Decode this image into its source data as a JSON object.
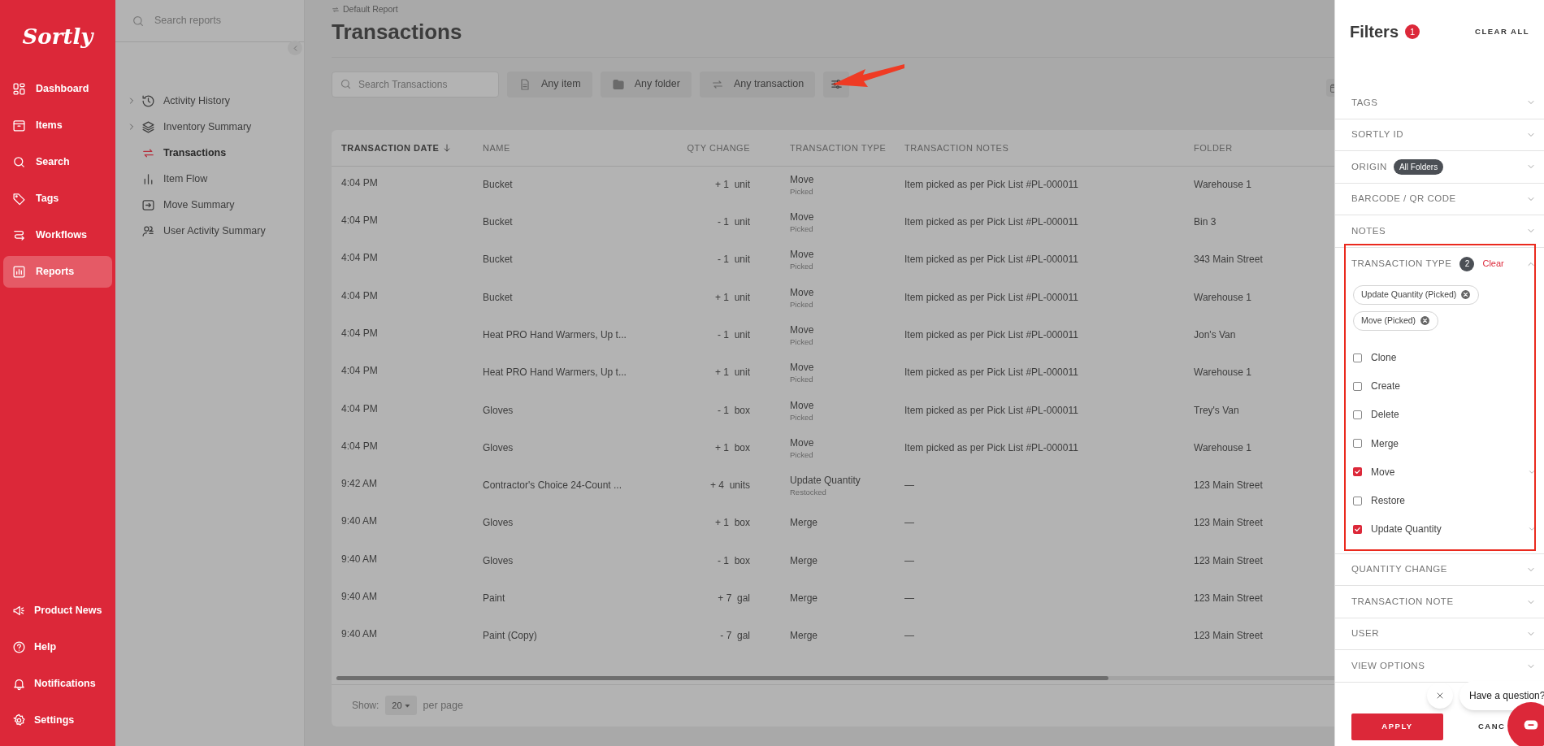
{
  "sidebar": {
    "logo": "Sortly",
    "items": [
      {
        "label": "Dashboard",
        "selected": false
      },
      {
        "label": "Items",
        "selected": false
      },
      {
        "label": "Search",
        "selected": false
      },
      {
        "label": "Tags",
        "selected": false
      },
      {
        "label": "Workflows",
        "selected": false
      },
      {
        "label": "Reports",
        "selected": true
      }
    ],
    "bottom_items": [
      {
        "label": "Product News"
      },
      {
        "label": "Help"
      },
      {
        "label": "Notifications"
      },
      {
        "label": "Settings"
      }
    ]
  },
  "reports_panel": {
    "search": {
      "placeholder": "Search reports"
    },
    "items": [
      {
        "label": "Activity History",
        "expandable": true,
        "selected": false
      },
      {
        "label": "Inventory Summary",
        "expandable": true,
        "selected": false
      },
      {
        "label": "Transactions",
        "expandable": false,
        "selected": true
      },
      {
        "label": "Item Flow",
        "expandable": false,
        "selected": false
      },
      {
        "label": "Move Summary",
        "expandable": false,
        "selected": false
      },
      {
        "label": "User Activity Summary",
        "expandable": false,
        "selected": false
      }
    ]
  },
  "main": {
    "breadcrumb": "Default Report",
    "title": "Transactions",
    "search": {
      "placeholder": "Search Transactions"
    },
    "filter_chips": [
      "Any item",
      "Any folder",
      "Any transaction"
    ],
    "table": {
      "columns": [
        "TRANSACTION DATE",
        "NAME",
        "QTY CHANGE",
        "TRANSACTION TYPE",
        "TRANSACTION NOTES",
        "FOLDER"
      ],
      "rows": [
        {
          "date": "4:04 PM",
          "name": "Bucket",
          "qty": "+ 1",
          "unit": "unit",
          "type": "Move",
          "subtype": "Picked",
          "notes": "Item picked as per Pick List #PL-000011",
          "folder": "Warehouse 1"
        },
        {
          "date": "4:04 PM",
          "name": "Bucket",
          "qty": "- 1",
          "unit": "unit",
          "type": "Move",
          "subtype": "Picked",
          "notes": "Item picked as per Pick List #PL-000011",
          "folder": "Bin 3"
        },
        {
          "date": "4:04 PM",
          "name": "Bucket",
          "qty": "- 1",
          "unit": "unit",
          "type": "Move",
          "subtype": "Picked",
          "notes": "Item picked as per Pick List #PL-000011",
          "folder": "343 Main Street"
        },
        {
          "date": "4:04 PM",
          "name": "Bucket",
          "qty": "+ 1",
          "unit": "unit",
          "type": "Move",
          "subtype": "Picked",
          "notes": "Item picked as per Pick List #PL-000011",
          "folder": "Warehouse 1"
        },
        {
          "date": "4:04 PM",
          "name": "Heat PRO Hand Warmers, Up t...",
          "qty": "- 1",
          "unit": "unit",
          "type": "Move",
          "subtype": "Picked",
          "notes": "Item picked as per Pick List #PL-000011",
          "folder": "Jon's Van"
        },
        {
          "date": "4:04 PM",
          "name": "Heat PRO Hand Warmers, Up t...",
          "qty": "+ 1",
          "unit": "unit",
          "type": "Move",
          "subtype": "Picked",
          "notes": "Item picked as per Pick List #PL-000011",
          "folder": "Warehouse 1"
        },
        {
          "date": "4:04 PM",
          "name": "Gloves",
          "qty": "- 1",
          "unit": "box",
          "type": "Move",
          "subtype": "Picked",
          "notes": "Item picked as per Pick List #PL-000011",
          "folder": "Trey's Van"
        },
        {
          "date": "4:04 PM",
          "name": "Gloves",
          "qty": "+ 1",
          "unit": "box",
          "type": "Move",
          "subtype": "Picked",
          "notes": "Item picked as per Pick List #PL-000011",
          "folder": "Warehouse 1"
        },
        {
          "date": "9:42 AM",
          "name": "Contractor's Choice 24-Count ...",
          "qty": "+ 4",
          "unit": "units",
          "type": "Update Quantity",
          "subtype": "Restocked",
          "notes": "—",
          "folder": "123 Main Street"
        },
        {
          "date": "9:40 AM",
          "name": "Gloves",
          "qty": "+ 1",
          "unit": "box",
          "type": "Merge",
          "notes": "—",
          "folder": "123 Main Street"
        },
        {
          "date": "9:40 AM",
          "name": "Gloves",
          "qty": "- 1",
          "unit": "box",
          "type": "Merge",
          "notes": "—",
          "folder": "123 Main Street"
        },
        {
          "date": "9:40 AM",
          "name": "Paint",
          "qty": "+ 7",
          "unit": "gal",
          "type": "Merge",
          "notes": "—",
          "folder": "123 Main Street"
        },
        {
          "date": "9:40 AM",
          "name": "Paint (Copy)",
          "qty": "- 7",
          "unit": "gal",
          "type": "Merge",
          "notes": "—",
          "folder": "123 Main Street"
        }
      ]
    },
    "pagination": {
      "label": "Show:",
      "value": "20",
      "suffix": "per page"
    }
  },
  "filters": {
    "title": "Filters",
    "count": "1",
    "clear_all": "CLEAR ALL",
    "sections": [
      {
        "kind": "collapsed",
        "label": "TAGS"
      },
      {
        "kind": "collapsed",
        "label": "SORTLY ID"
      },
      {
        "kind": "collapsed",
        "label": "ORIGIN",
        "badge": "All Folders"
      },
      {
        "kind": "collapsed",
        "label": "BARCODE / QR CODE"
      },
      {
        "kind": "collapsed",
        "label": "NOTES"
      },
      {
        "kind": "expanded",
        "label": "TRANSACTION TYPE",
        "count": "2",
        "clear": "Clear",
        "chips": [
          "Update Quantity (Picked)",
          "Move (Picked)"
        ],
        "options": [
          {
            "label": "Clone",
            "checked": false,
            "expandable": false
          },
          {
            "label": "Create",
            "checked": false,
            "expandable": false
          },
          {
            "label": "Delete",
            "checked": false,
            "expandable": false
          },
          {
            "label": "Merge",
            "checked": false,
            "expandable": false
          },
          {
            "label": "Move",
            "checked": true,
            "expandable": true
          },
          {
            "label": "Restore",
            "checked": false,
            "expandable": false
          },
          {
            "label": "Update Quantity",
            "checked": true,
            "expandable": true
          }
        ]
      },
      {
        "kind": "collapsed",
        "label": "QUANTITY CHANGE"
      },
      {
        "kind": "collapsed",
        "label": "TRANSACTION NOTE"
      },
      {
        "kind": "collapsed",
        "label": "USER"
      },
      {
        "kind": "collapsed",
        "label": "VIEW OPTIONS"
      }
    ],
    "apply": "APPLY",
    "cancel": "CANC"
  },
  "chat": {
    "message": "Have a question?"
  }
}
